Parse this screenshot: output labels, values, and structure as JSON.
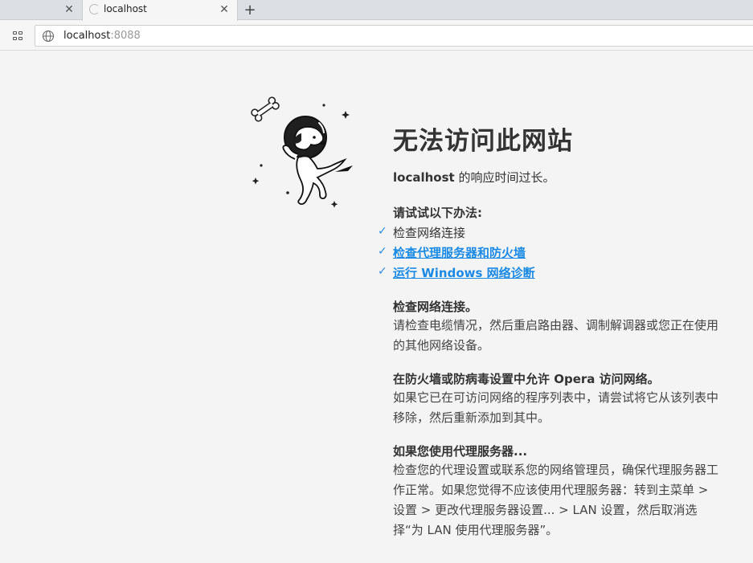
{
  "browser": {
    "tabs": [
      {
        "title": "",
        "close": "✕"
      },
      {
        "title": "localhost",
        "close": "✕"
      }
    ],
    "new_tab": "+",
    "url_host": "localhost",
    "url_port": ":8088"
  },
  "error": {
    "title": "无法访问此网站",
    "host": "localhost",
    "subtitle_rest": " 的响应时间过长。",
    "try_heading": "请试试以下办法:",
    "suggestions": [
      {
        "label": "检查网络连接"
      },
      {
        "label": "检查代理服务器和防火墙"
      },
      {
        "label": "运行 Windows 网络诊断"
      }
    ],
    "sections": [
      {
        "title": "检查网络连接。",
        "body": "请检查电缆情况，然后重启路由器、调制解调器或您正在使用的其他网络设备。"
      },
      {
        "title": "在防火墙或防病毒设置中允许 Opera 访问网络。",
        "body": "如果它已在可访问网络的程序列表中，请尝试将它从该列表中移除，然后重新添加到其中。"
      },
      {
        "title": "如果您使用代理服务器...",
        "body": "检查您的代理设置或联系您的网络管理员，确保代理服务器工作正常。如果您觉得不应该使用代理服务器：转到主菜单 > 设置 > 更改代理服务器设置... > LAN 设置，然后取消选择“为 LAN 使用代理服务器”。"
      }
    ],
    "check_glyph": "✓"
  },
  "colors": {
    "link": "#1a8ae6",
    "check": "#2a8be4"
  }
}
